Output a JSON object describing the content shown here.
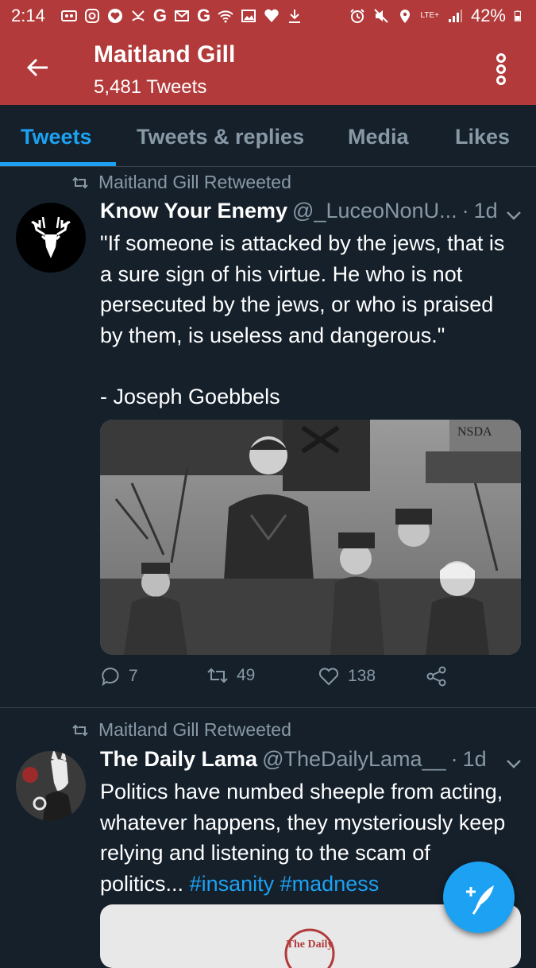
{
  "status_bar": {
    "time": "2:14",
    "battery": "42%",
    "network": "LTE+",
    "g1": "G",
    "g2": "G"
  },
  "app_bar": {
    "title": "Maitland Gill",
    "subtitle": "5,481 Tweets"
  },
  "tabs": [
    {
      "label": "Tweets",
      "active": true
    },
    {
      "label": "Tweets & replies",
      "active": false
    },
    {
      "label": "Media",
      "active": false
    },
    {
      "label": "Likes",
      "active": false
    }
  ],
  "tweets": [
    {
      "retweet_label": "Maitland Gill Retweeted",
      "name": "Know Your Enemy",
      "handle": "@_LuceoNonU...",
      "separator": "·",
      "age": "1d",
      "text_lines": [
        "\"If someone is attacked by the jews, that is",
        "a sure sign of his virtue. He who is not",
        "persecuted by the jews, or who is praised",
        "by them, is useless and dangerous.\"",
        "",
        "- Joseph Goebbels"
      ],
      "photo_sign": "NSDA",
      "replies": "7",
      "retweets": "49",
      "likes": "138"
    },
    {
      "retweet_label": "Maitland Gill Retweeted",
      "name": "The Daily Lama",
      "handle": "@TheDailyLama__",
      "separator": "·",
      "age": "1d",
      "text_lines": [
        "Politics have numbed sheeple from acting,",
        "whatever happens, they mysteriously keep",
        "relying and listening to the scam of"
      ],
      "text_last": "politics...",
      "hashtags": [
        "#insanity",
        "#madness"
      ],
      "card_logo": "The Daily"
    }
  ],
  "colors": {
    "accent": "#1da1f2",
    "header": "#b23a3a",
    "background": "#15202b",
    "muted": "#8899a6"
  }
}
